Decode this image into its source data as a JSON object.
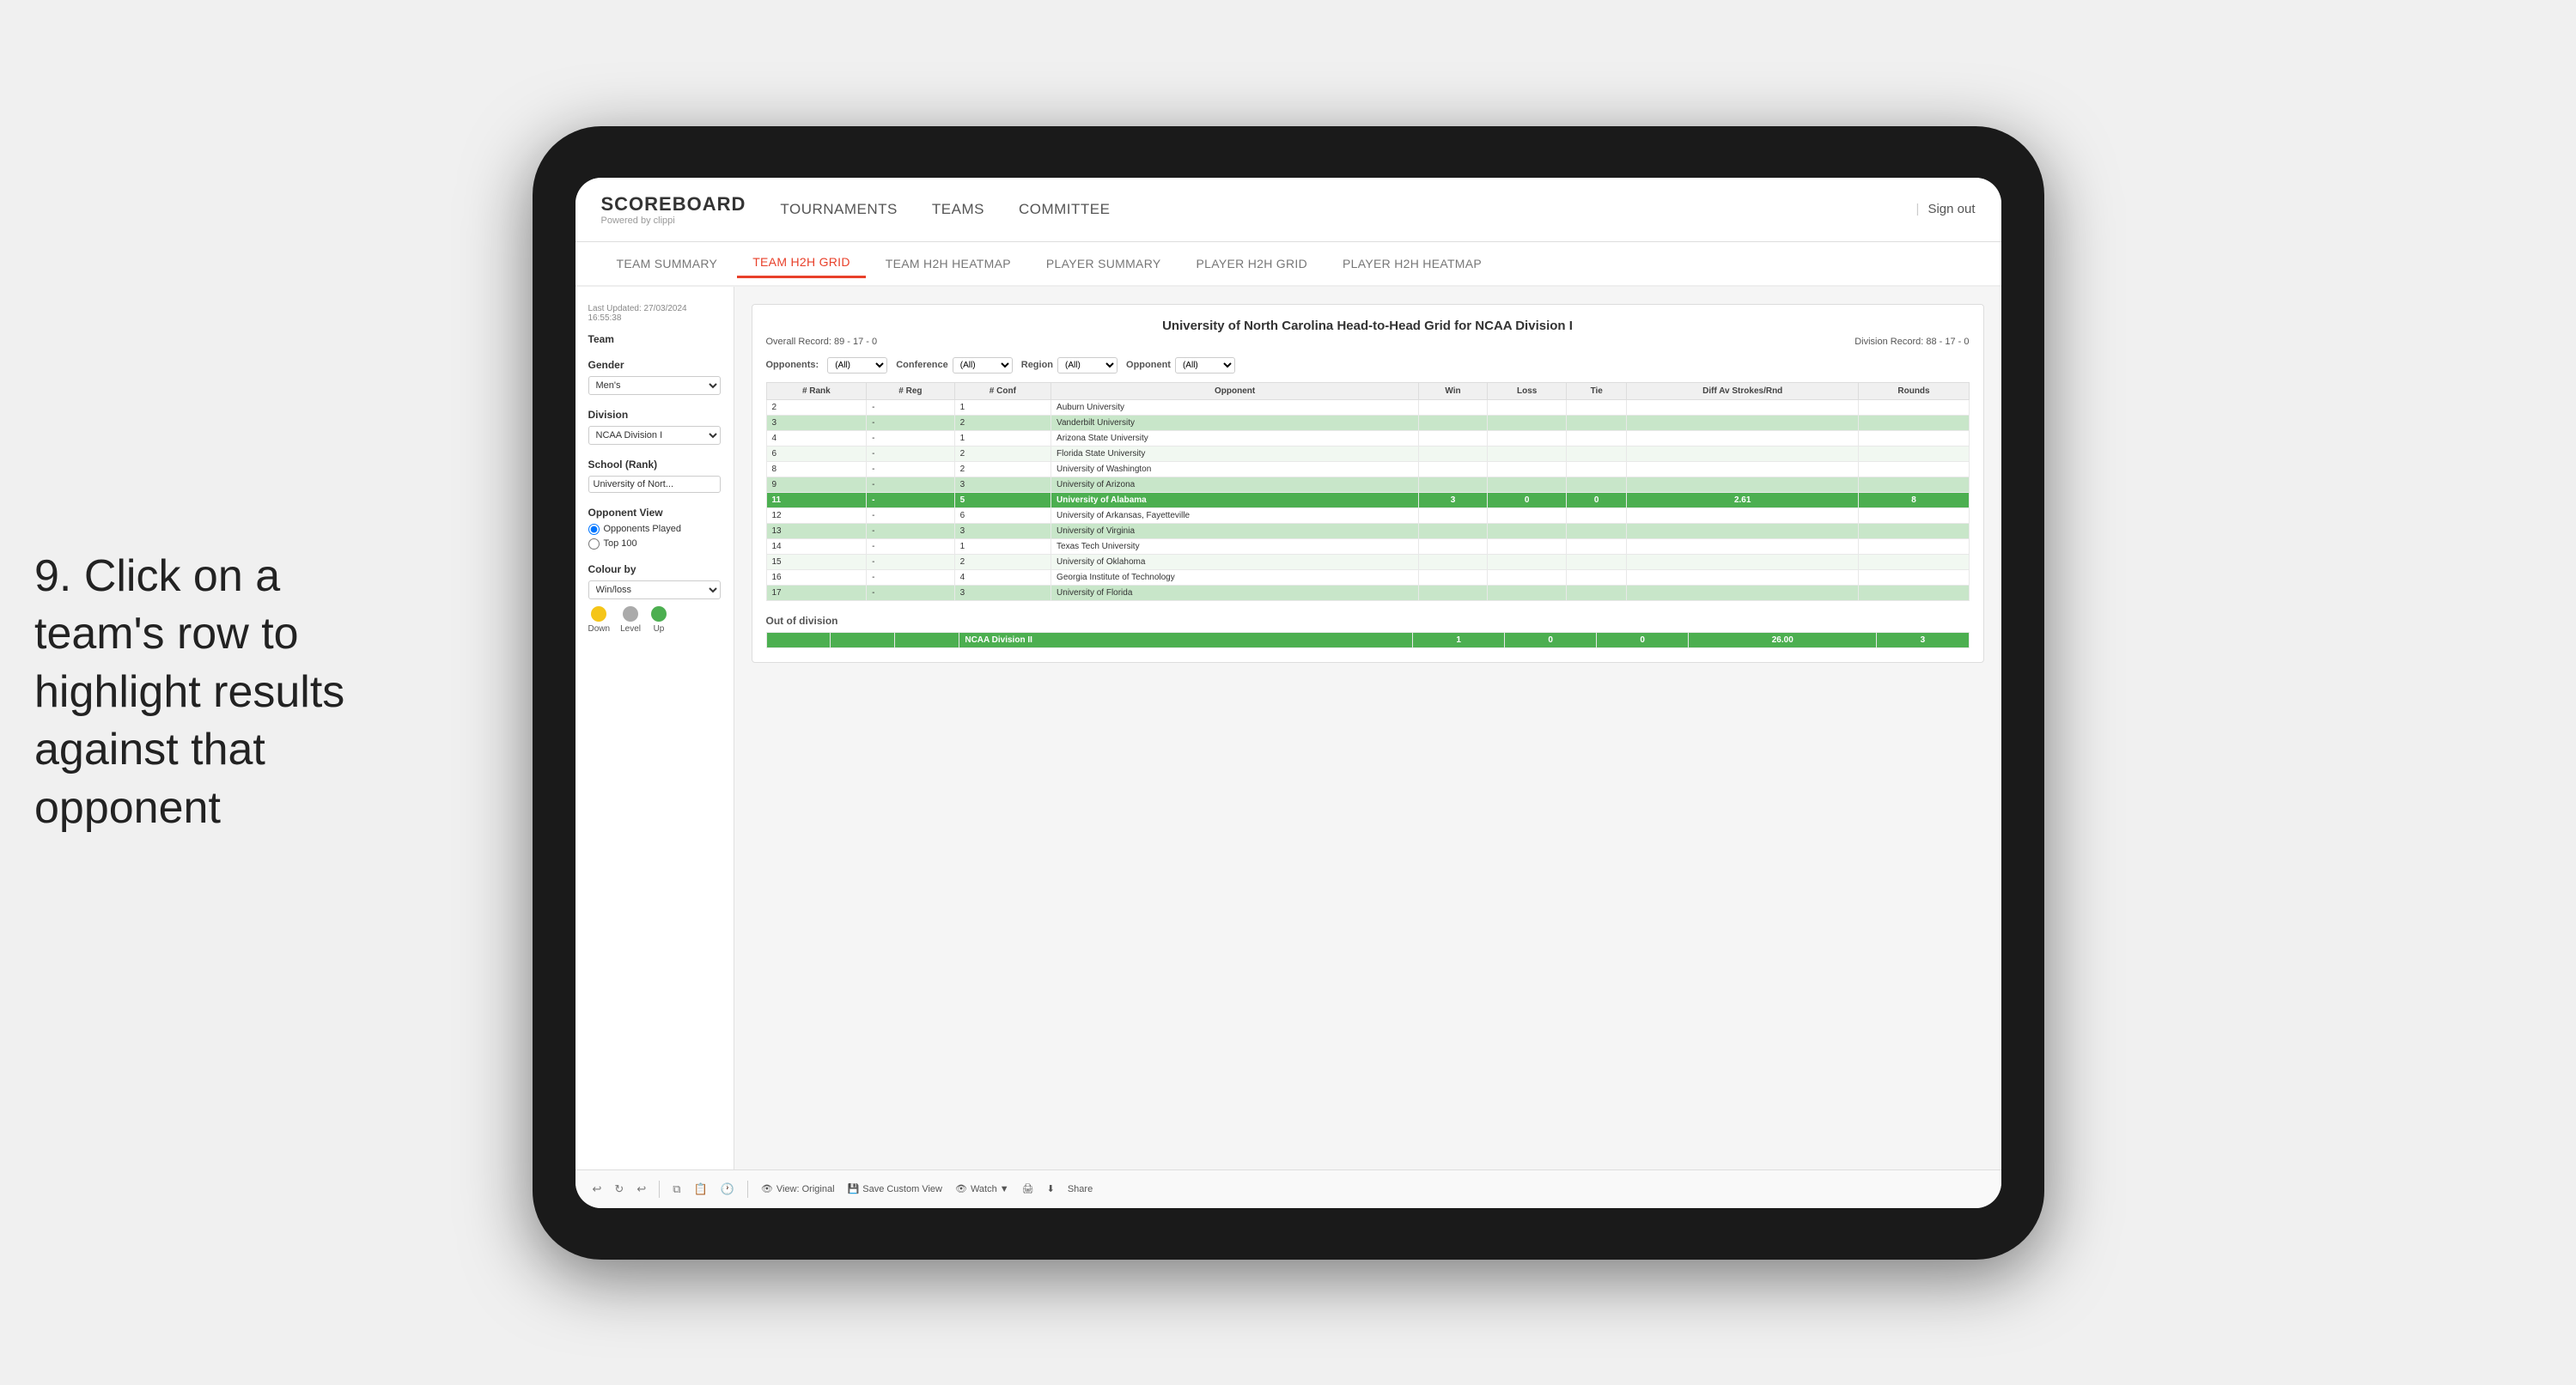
{
  "instruction": {
    "number": "9.",
    "text": "Click on a team's row to highlight results against that opponent"
  },
  "nav": {
    "logo": "SCOREBOARD",
    "logo_sub": "Powered by clippi",
    "items": [
      "TOURNAMENTS",
      "TEAMS",
      "COMMITTEE"
    ],
    "sign_out": "Sign out"
  },
  "sub_nav": {
    "items": [
      "TEAM SUMMARY",
      "TEAM H2H GRID",
      "TEAM H2H HEATMAP",
      "PLAYER SUMMARY",
      "PLAYER H2H GRID",
      "PLAYER H2H HEATMAP"
    ],
    "active": "TEAM H2H GRID"
  },
  "sidebar": {
    "timestamp_label": "Last Updated: 27/03/2024",
    "timestamp_time": "16:55:38",
    "team_label": "Team",
    "gender_label": "Gender",
    "gender_value": "Men's",
    "division_label": "Division",
    "division_value": "NCAA Division I",
    "school_label": "School (Rank)",
    "school_value": "University of Nort...",
    "opponent_view_label": "Opponent View",
    "opponent_view_options": [
      "Opponents Played",
      "Top 100"
    ],
    "colour_label": "Colour by",
    "colour_value": "Win/loss",
    "colours": [
      {
        "name": "Down",
        "color": "#f5c518"
      },
      {
        "name": "Level",
        "color": "#aaaaaa"
      },
      {
        "name": "Up",
        "color": "#4caf50"
      }
    ]
  },
  "grid": {
    "title": "University of North Carolina Head-to-Head Grid for NCAA Division I",
    "overall_record": "Overall Record: 89 - 17 - 0",
    "division_record": "Division Record: 88 - 17 - 0",
    "filters": {
      "opponents_label": "Opponents:",
      "opponents_value": "(All)",
      "conference_label": "Conference",
      "conference_value": "(All)",
      "region_label": "Region",
      "region_value": "(All)",
      "opponent_label": "Opponent",
      "opponent_value": "(All)"
    },
    "columns": [
      "# Rank",
      "# Reg",
      "# Conf",
      "Opponent",
      "Win",
      "Loss",
      "Tie",
      "Diff Av Strokes/Rnd",
      "Rounds"
    ],
    "rows": [
      {
        "rank": "2",
        "reg": "-",
        "conf": "1",
        "opponent": "Auburn University",
        "win": "",
        "loss": "",
        "tie": "",
        "diff": "",
        "rounds": "",
        "style": "normal"
      },
      {
        "rank": "3",
        "reg": "-",
        "conf": "2",
        "opponent": "Vanderbilt University",
        "win": "",
        "loss": "",
        "tie": "",
        "diff": "",
        "rounds": "",
        "style": "light-green"
      },
      {
        "rank": "4",
        "reg": "-",
        "conf": "1",
        "opponent": "Arizona State University",
        "win": "",
        "loss": "",
        "tie": "",
        "diff": "",
        "rounds": "",
        "style": "normal"
      },
      {
        "rank": "6",
        "reg": "-",
        "conf": "2",
        "opponent": "Florida State University",
        "win": "",
        "loss": "",
        "tie": "",
        "diff": "",
        "rounds": "",
        "style": "very-light-green"
      },
      {
        "rank": "8",
        "reg": "-",
        "conf": "2",
        "opponent": "University of Washington",
        "win": "",
        "loss": "",
        "tie": "",
        "diff": "",
        "rounds": "",
        "style": "normal"
      },
      {
        "rank": "9",
        "reg": "-",
        "conf": "3",
        "opponent": "University of Arizona",
        "win": "",
        "loss": "",
        "tie": "",
        "diff": "",
        "rounds": "",
        "style": "light-green"
      },
      {
        "rank": "11",
        "reg": "-",
        "conf": "5",
        "opponent": "University of Alabama",
        "win": "3",
        "loss": "0",
        "tie": "0",
        "diff": "2.61",
        "rounds": "8",
        "style": "highlighted"
      },
      {
        "rank": "12",
        "reg": "-",
        "conf": "6",
        "opponent": "University of Arkansas, Fayetteville",
        "win": "",
        "loss": "",
        "tie": "",
        "diff": "",
        "rounds": "",
        "style": "normal"
      },
      {
        "rank": "13",
        "reg": "-",
        "conf": "3",
        "opponent": "University of Virginia",
        "win": "",
        "loss": "",
        "tie": "",
        "diff": "",
        "rounds": "",
        "style": "light-green"
      },
      {
        "rank": "14",
        "reg": "-",
        "conf": "1",
        "opponent": "Texas Tech University",
        "win": "",
        "loss": "",
        "tie": "",
        "diff": "",
        "rounds": "",
        "style": "normal"
      },
      {
        "rank": "15",
        "reg": "-",
        "conf": "2",
        "opponent": "University of Oklahoma",
        "win": "",
        "loss": "",
        "tie": "",
        "diff": "",
        "rounds": "",
        "style": "very-light-green"
      },
      {
        "rank": "16",
        "reg": "-",
        "conf": "4",
        "opponent": "Georgia Institute of Technology",
        "win": "",
        "loss": "",
        "tie": "",
        "diff": "",
        "rounds": "",
        "style": "normal"
      },
      {
        "rank": "17",
        "reg": "-",
        "conf": "3",
        "opponent": "University of Florida",
        "win": "",
        "loss": "",
        "tie": "",
        "diff": "",
        "rounds": "",
        "style": "light-green"
      }
    ],
    "out_of_division_label": "Out of division",
    "out_of_division_row": {
      "division": "NCAA Division II",
      "win": "1",
      "loss": "0",
      "tie": "0",
      "diff": "26.00",
      "rounds": "3"
    }
  },
  "toolbar": {
    "buttons": [
      "View: Original",
      "Save Custom View",
      "Watch ▼",
      "Share"
    ]
  }
}
